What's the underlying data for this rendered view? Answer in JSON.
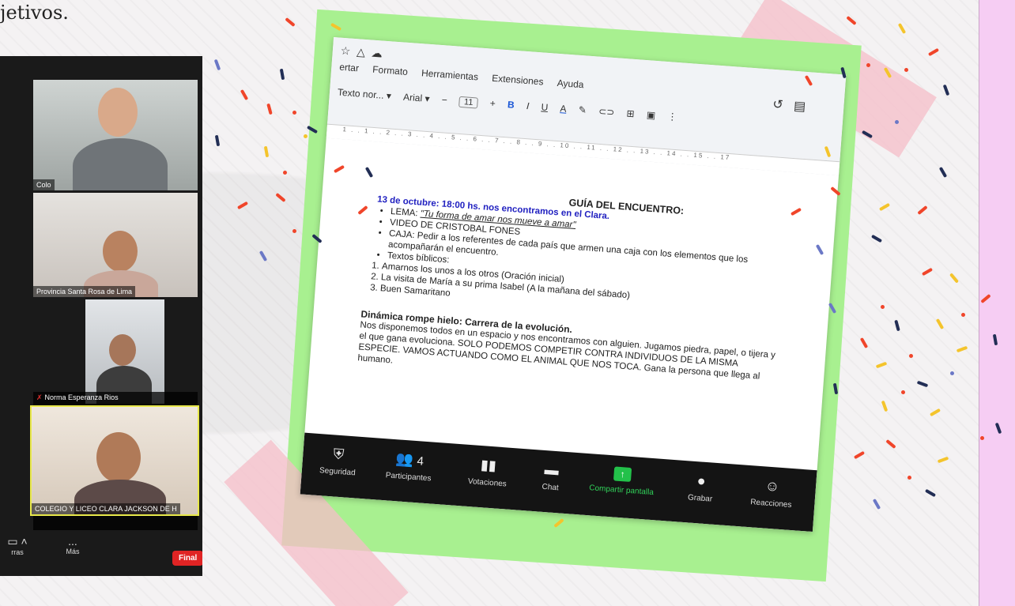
{
  "page": {
    "heading_fragment": "jetivos."
  },
  "zoom": {
    "participants": [
      {
        "name": "Colo"
      },
      {
        "name": "Provincia Santa Rosa de Lima"
      },
      {
        "name": "Norma Esperanza Rios"
      },
      {
        "name": "COLEGIO Y LICEO CLARA JACKSON DE H"
      }
    ],
    "toolbar": {
      "cameras": "rras",
      "more": "Más",
      "more_icon": "...",
      "end": "Final"
    }
  },
  "docs": {
    "menu": [
      "ertar",
      "Formato",
      "Herramientas",
      "Extensiones",
      "Ayuda"
    ],
    "toolbar": {
      "style": "Texto nor...",
      "font": "Arial",
      "size": "11",
      "minus": "−",
      "plus": "+",
      "bold": "B",
      "italic": "I",
      "underline": "U",
      "color": "A"
    },
    "ruler": "1 . . 1 . . 2 . . 3 . . 4 . . 5 . . 6 . . 7 . . 8 . . 9 . . 10 . . 11 . . 12 . . 13 . . 14 . . 15 . . 17",
    "doc": {
      "title": "GUÍA DEL ENCUENTRO:",
      "date": "13 de octubre: 18:00 hs. nos encontramos en el Clara.",
      "lema_label": "LEMA: ",
      "lema": "\"Tu forma de amar nos mueve a amar\"",
      "video": "VIDEO DE CRISTOBAL FONES",
      "caja_label": "CAJA: ",
      "caja": "Pedir a los referentes de cada país que armen una caja  con los elementos que los acompañarán el encuentro.",
      "textos": "Textos bíblicos:",
      "readings": [
        "Amarnos los unos a los otros (Oración inicial)",
        "La visita de María a su prima Isabel (A la mañana del sábado)",
        "Buen Samaritano"
      ],
      "dynamic_title": "Dinámica rompe hielo: Carrera de la evolución.",
      "dynamic_text": "Nos disponemos todos en un espacio y nos encontramos con alguien. Jugamos piedra, papel, o tijera y el que gana evoluciona. SOLO PODEMOS COMPETIR CONTRA INDIVIDUOS DE LA MISMA ESPECIE. VAMOS ACTUANDO COMO EL ANIMAL QUE NOS TOCA. Gana la persona que llega al humano."
    }
  },
  "meeting_bar": {
    "security": "Seguridad",
    "participants": "Participantes",
    "participants_count": "4",
    "polls": "Votaciones",
    "chat": "Chat",
    "share": "Compartir pantalla",
    "record": "Grabar",
    "reactions": "Reacciones"
  },
  "colors": {
    "green_card": "#a8f090",
    "pink_strip": "#f6cdf3",
    "share_green": "#23c14a",
    "end_red": "#e02424"
  }
}
